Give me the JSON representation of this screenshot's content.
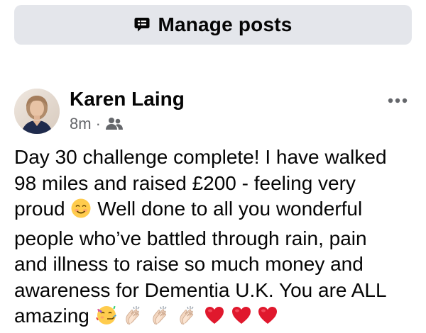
{
  "header": {
    "manage_posts_label": "Manage posts",
    "manage_icon": "manage-posts-icon"
  },
  "post": {
    "author": "Karen Laing",
    "time": "8m",
    "meta_separator": "·",
    "audience_icon": "friends-icon",
    "more_icon": "more-options-icon",
    "text": {
      "line1": "Day 30 challenge complete! I have walked",
      "line2": "98 miles and raised £200 - feeling very",
      "line3a": "proud",
      "line3b": "Well done to all you wonderful",
      "line4": "people who’ve battled through rain, pain",
      "line5": "and illness to raise so much money and",
      "line6": "awareness for Dementia U.K. You are ALL",
      "line7": "amazing"
    },
    "emojis": {
      "smile": "smiling-face-emoji",
      "party": "partying-face-emoji",
      "clap": "clapping-hands-emoji",
      "heart": "red-heart-emoji"
    }
  },
  "colors": {
    "button_bg": "#e4e6eb",
    "text": "#050505",
    "meta": "#65676b",
    "heart": "#e0182d"
  }
}
